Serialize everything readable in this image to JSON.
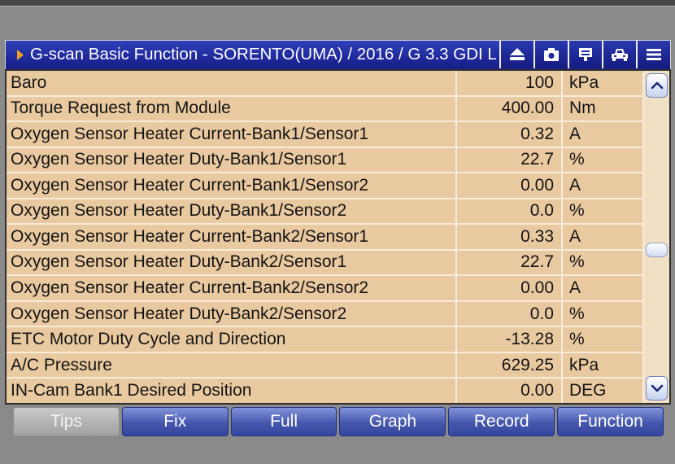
{
  "colors": {
    "background": "#8a8a8a",
    "title_bar": "#1e2a9c",
    "row_bg": "#e9c9a0",
    "row_line": "#f7ecdc",
    "scroll_track": "#f1e0c4",
    "button": "#4557ad",
    "button_disabled": "#b2b2b2",
    "accent_arrow": "#f0a020"
  },
  "title_bar": {
    "marker_icon": "play-arrow-icon",
    "title": "G-scan Basic Function - SORENTO(UMA) / 2016 / G 3.3 GDI L",
    "icons": [
      "eject-icon",
      "camera-icon",
      "comment-icon",
      "car-icon",
      "menu-icon"
    ]
  },
  "table": {
    "rows": [
      {
        "name": "Baro",
        "value": "100",
        "unit": "kPa"
      },
      {
        "name": "Torque Request from Module",
        "value": "400.00",
        "unit": "Nm"
      },
      {
        "name": "Oxygen Sensor Heater Current-Bank1/Sensor1",
        "value": "0.32",
        "unit": "A"
      },
      {
        "name": "Oxygen Sensor Heater Duty-Bank1/Sensor1",
        "value": "22.7",
        "unit": "%"
      },
      {
        "name": "Oxygen Sensor Heater Current-Bank1/Sensor2",
        "value": "0.00",
        "unit": "A"
      },
      {
        "name": "Oxygen Sensor Heater Duty-Bank1/Sensor2",
        "value": "0.0",
        "unit": "%"
      },
      {
        "name": "Oxygen Sensor Heater Current-Bank2/Sensor1",
        "value": "0.33",
        "unit": "A"
      },
      {
        "name": "Oxygen Sensor Heater Duty-Bank2/Sensor1",
        "value": "22.7",
        "unit": "%"
      },
      {
        "name": "Oxygen Sensor Heater Current-Bank2/Sensor2",
        "value": "0.00",
        "unit": "A"
      },
      {
        "name": "Oxygen Sensor Heater Duty-Bank2/Sensor2",
        "value": "0.0",
        "unit": "%"
      },
      {
        "name": "ETC Motor Duty Cycle and Direction",
        "value": "-13.28",
        "unit": "%"
      },
      {
        "name": "A/C Pressure",
        "value": "629.25",
        "unit": "kPa"
      },
      {
        "name": "IN-Cam Bank1 Desired Position",
        "value": "0.00",
        "unit": "DEG"
      }
    ]
  },
  "scrollbar": {
    "position": 0.55,
    "up_icon": "chevron-up-icon",
    "down_icon": "chevron-down-icon"
  },
  "buttons": [
    {
      "label": "Tips",
      "enabled": false
    },
    {
      "label": "Fix",
      "enabled": true
    },
    {
      "label": "Full",
      "enabled": true
    },
    {
      "label": "Graph",
      "enabled": true
    },
    {
      "label": "Record",
      "enabled": true
    },
    {
      "label": "Function",
      "enabled": true
    }
  ]
}
